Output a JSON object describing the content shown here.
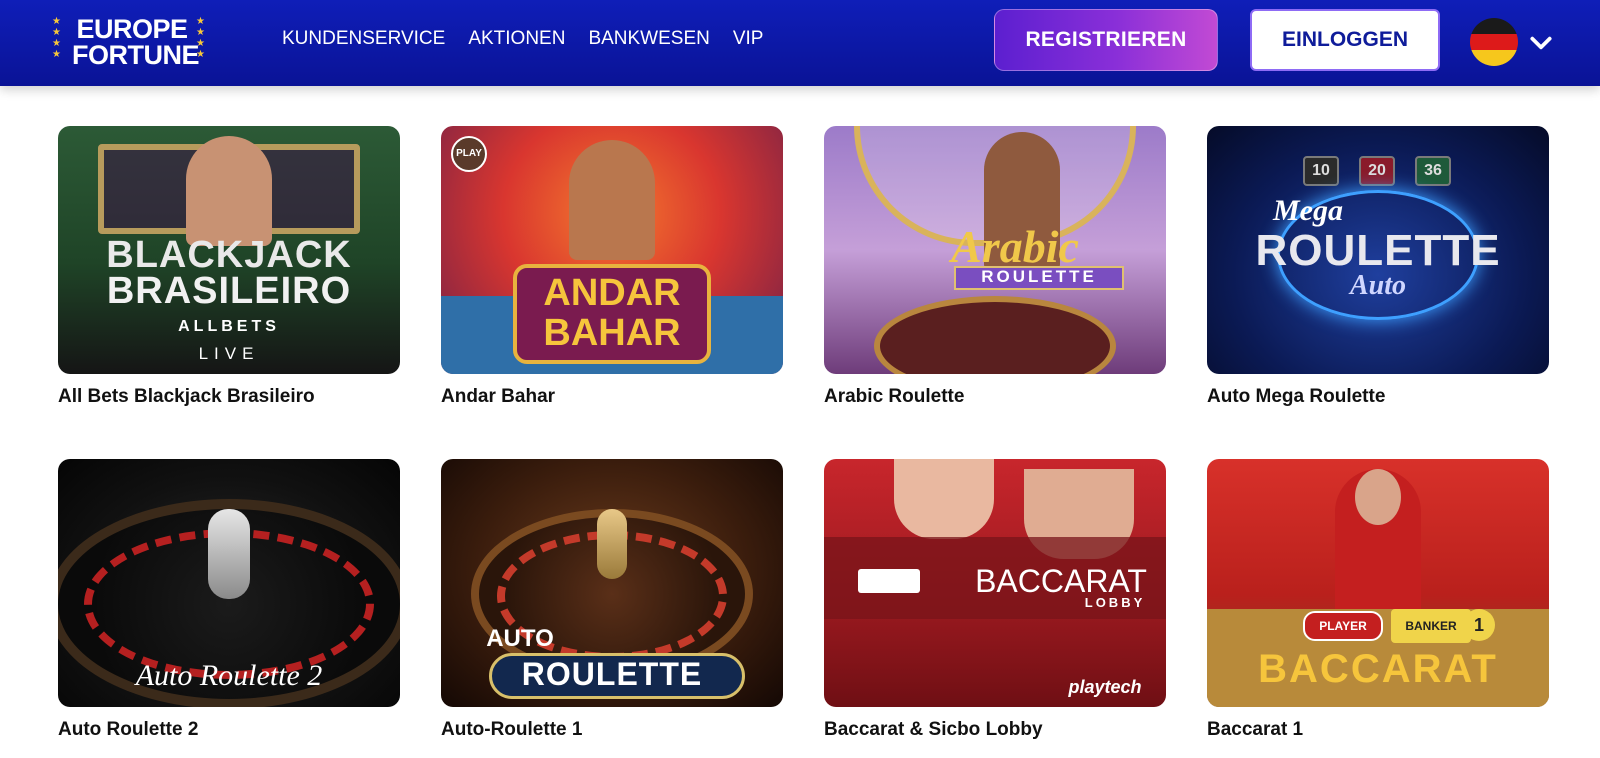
{
  "header": {
    "logo_line1": "EUROPE",
    "logo_line2": "FORTUNE",
    "logo_stars": "★ ★ ★",
    "nav": [
      "KUNDENSERVICE",
      "AKTIONEN",
      "BANKWESEN",
      "VIP"
    ],
    "register_label": "REGISTRIEREN",
    "login_label": "EINLOGGEN",
    "language_flag": "de-flag-icon",
    "language_dropdown_icon": "chevron-down-icon"
  },
  "games": [
    {
      "title": "All Bets Blackjack Brasileiro",
      "thumb_lines": [
        "BLACKJACK",
        "BRASILEIRO",
        "ALLBETS",
        "LIVE"
      ]
    },
    {
      "title": "Andar Bahar",
      "thumb_lines": [
        "ANDAR",
        "BAHAR",
        "PLAY"
      ]
    },
    {
      "title": "Arabic Roulette",
      "thumb_lines": [
        "Arabic",
        "ROULETTE"
      ]
    },
    {
      "title": "Auto Mega Roulette",
      "thumb_lines": [
        "Mega",
        "ROULETTE",
        "Auto",
        "10",
        "20",
        "36"
      ]
    },
    {
      "title": "Auto Roulette 2",
      "thumb_lines": [
        "Auto Roulette 2"
      ]
    },
    {
      "title": "Auto-Roulette 1",
      "thumb_lines": [
        "AUTO",
        "ROULETTE"
      ]
    },
    {
      "title": "Baccarat & Sicbo Lobby",
      "thumb_lines": [
        "BACCARAT",
        "LOBBY",
        "playtech"
      ]
    },
    {
      "title": "Baccarat 1",
      "thumb_lines": [
        "BACCARAT",
        "PLAYER",
        "BANKER",
        "1"
      ]
    }
  ],
  "colors": {
    "header_bg": "#0f1eb8",
    "register_gradient_start": "#5c1fd0",
    "register_gradient_end": "#c24ad4",
    "login_text": "#0f1c9a"
  }
}
